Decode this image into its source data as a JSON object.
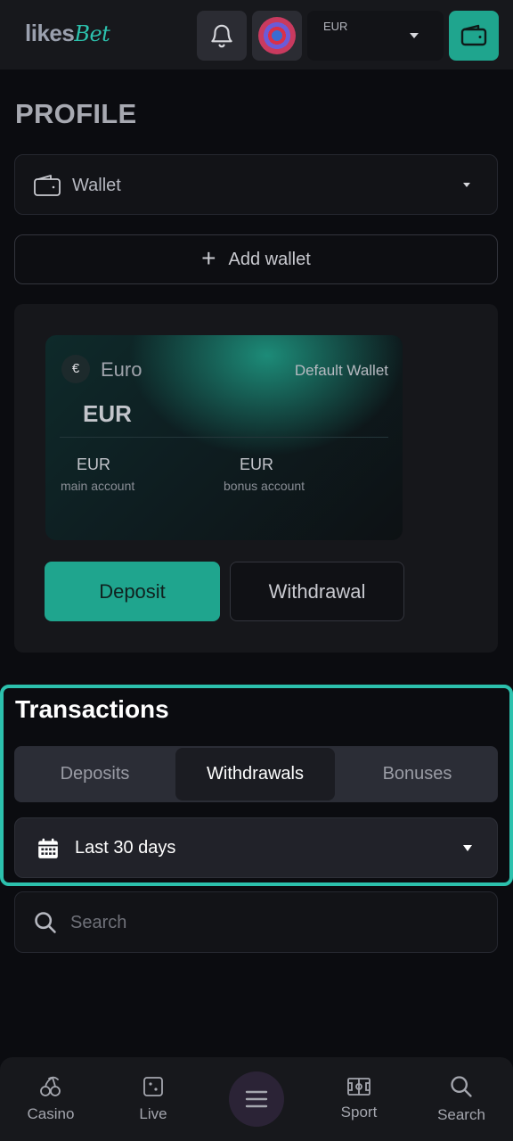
{
  "header": {
    "logo_part1": "likes",
    "logo_part2": "Bet",
    "currency_label": "EUR",
    "icons": {
      "bell": "bell-icon",
      "avatar": "avatar",
      "wallet": "wallet-icon"
    }
  },
  "profile": {
    "title": "PROFILE",
    "wallet_select_label": "Wallet",
    "add_wallet_label": "Add wallet"
  },
  "wallet_card": {
    "currency_symbol": "€",
    "currency_name": "Euro",
    "default_label": "Default Wallet",
    "balance": "EUR",
    "main_currency": "EUR",
    "main_label": "main account",
    "bonus_currency": "EUR",
    "bonus_label": "bonus account"
  },
  "actions": {
    "deposit_label": "Deposit",
    "withdrawal_label": "Withdrawal"
  },
  "transactions": {
    "title": "Transactions",
    "tabs": [
      {
        "label": "Deposits",
        "active": false
      },
      {
        "label": "Withdrawals",
        "active": true
      },
      {
        "label": "Bonuses",
        "active": false
      }
    ],
    "date_range": "Last 30 days",
    "search_placeholder": "Search"
  },
  "bottom_nav": {
    "items": [
      {
        "label": "Casino",
        "icon": "cherries-icon"
      },
      {
        "label": "Live",
        "icon": "dice-icon"
      },
      {
        "label": "",
        "icon": "menu-icon"
      },
      {
        "label": "Sport",
        "icon": "field-icon"
      },
      {
        "label": "Search",
        "icon": "search-icon"
      }
    ]
  },
  "colors": {
    "accent": "#1fa58e",
    "highlight_border": "#2cc1ad",
    "background": "#0b0c10"
  }
}
